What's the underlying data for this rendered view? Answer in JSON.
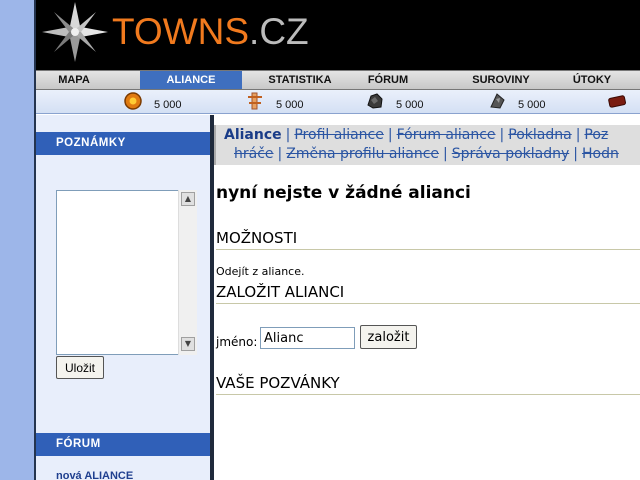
{
  "logo": {
    "name_part": "TOWNS",
    "domain_part": ".CZ"
  },
  "nav": {
    "items": [
      {
        "label": "MAPA",
        "active": false
      },
      {
        "label": "ALIANCE",
        "active": true
      },
      {
        "label": "STATISTIKA",
        "active": false
      },
      {
        "label": "FÓRUM",
        "active": false
      },
      {
        "label": "SUROVINY",
        "active": false
      },
      {
        "label": "ÚTOKY",
        "active": false
      }
    ]
  },
  "resources": [
    {
      "icon": "gold-coin-icon",
      "value": "5 000"
    },
    {
      "icon": "food-icon",
      "value": "5 000"
    },
    {
      "icon": "stone-icon",
      "value": "5 000"
    },
    {
      "icon": "iron-icon",
      "value": "5 000"
    },
    {
      "icon": "wood-icon",
      "value": ""
    }
  ],
  "sidebar": {
    "notes_title": "POZNÁMKY",
    "save_label": "Uložit",
    "forum_title": "FÓRUM",
    "forum_link": "nová ALIANCE"
  },
  "subnav": {
    "current": "Aliance",
    "line1": [
      "Profil aliance",
      "Fórum aliance",
      "Pokladna",
      "Poz"
    ],
    "line2_prefix": "hráče",
    "line2": [
      "Změna profilu aliance",
      "Správa pokladny",
      "Hodn"
    ]
  },
  "main": {
    "title": "nyní nejste v žádné alianci",
    "options_heading": "MOŽNOSTI",
    "leave_link": "Odejít z aliance.",
    "found_heading": "ZALOŽIT ALIANCI",
    "name_label": "jméno:",
    "name_value": "Alianc",
    "found_button": "založit",
    "invites_heading": "VAŠE POZVÁNKY"
  },
  "colors": {
    "brand_orange": "#f17a1e",
    "active_tab": "#3f6fbf",
    "sidebar_header": "#3060b8",
    "link_blue": "#2b55a3"
  }
}
